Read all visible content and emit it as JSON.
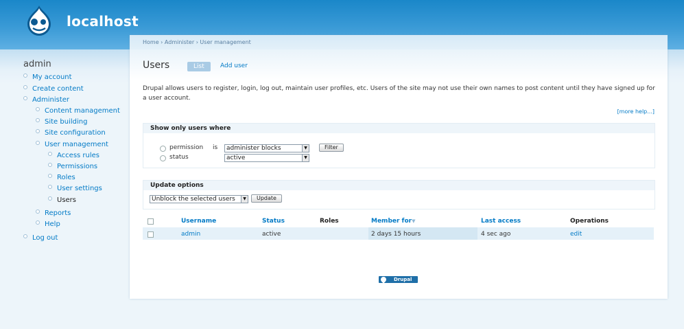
{
  "site": {
    "name": "localhost"
  },
  "breadcrumb": "Home › Administer › User management",
  "page": {
    "title": "Users",
    "tabs": [
      {
        "label": "List",
        "active": true
      },
      {
        "label": "Add user",
        "active": false
      }
    ],
    "intro": "Drupal allows users to register, login, log out, maintain user profiles, etc. Users of the site may not use their own names to post content until they have signed up for a user account.",
    "more_help": "[more help...]"
  },
  "sidebar": {
    "heading": "admin",
    "items": [
      {
        "label": "My account",
        "level": 0
      },
      {
        "label": "Create content",
        "level": 0
      },
      {
        "label": "Administer",
        "level": 0
      },
      {
        "label": "Content management",
        "level": 1
      },
      {
        "label": "Site building",
        "level": 1
      },
      {
        "label": "Site configuration",
        "level": 1
      },
      {
        "label": "User management",
        "level": 1
      },
      {
        "label": "Access rules",
        "level": 2
      },
      {
        "label": "Permissions",
        "level": 2
      },
      {
        "label": "Roles",
        "level": 2
      },
      {
        "label": "User settings",
        "level": 2
      },
      {
        "label": "Users",
        "level": 2,
        "active": true
      },
      {
        "label": "Reports",
        "level": 1
      },
      {
        "label": "Help",
        "level": 1
      },
      {
        "label": "Log out",
        "level": 0
      }
    ]
  },
  "filter": {
    "legend": "Show only users where",
    "permission_label": "permission",
    "is_label": "is",
    "permission_value": "administer blocks",
    "status_label": "status",
    "status_value": "active",
    "filter_button": "Filter"
  },
  "update": {
    "legend": "Update options",
    "selected_option": "Unblock the selected users",
    "update_button": "Update"
  },
  "table": {
    "headers": {
      "username": "Username",
      "status": "Status",
      "roles": "Roles",
      "member_for": "Member for",
      "last_access": "Last access",
      "operations": "Operations"
    },
    "rows": [
      {
        "username": "admin",
        "status": "active",
        "roles": "",
        "member_for": "2 days 15 hours",
        "last_access": "4 sec ago",
        "operation": "edit"
      }
    ]
  },
  "footer": {
    "badge": "Drupal"
  },
  "icons": {
    "logo": "drupal-drop-icon",
    "sort": "sort-desc-icon",
    "select_arrow": "chevron-down-icon"
  },
  "colors": {
    "header_blue": "#1a87c9",
    "link": "#027ac6",
    "page_bg": "#edf5fa",
    "active_tab": "#a9cbe5"
  }
}
